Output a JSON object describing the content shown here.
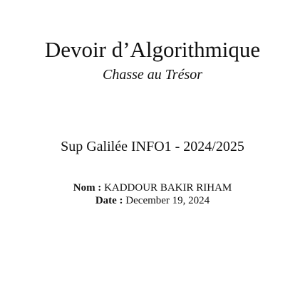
{
  "document": {
    "title": "Devoir d’Algorithmique",
    "subtitle": "Chasse au Trésor",
    "course": "Sup Galilée INFO1 - 2024/2025",
    "author": {
      "label": "Nom :",
      "value": "KADDOUR BAKIR RIHAM"
    },
    "date": {
      "label": "Date :",
      "value": "December 19, 2024"
    }
  }
}
